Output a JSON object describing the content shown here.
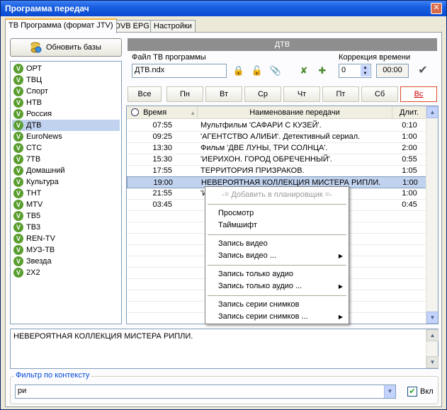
{
  "window": {
    "title": "Программа передач",
    "close_glyph": "✕"
  },
  "tabs": [
    "ТВ Программа (формат JTV)",
    "DVB EPG",
    "Настройки"
  ],
  "refresh_button": {
    "label": "Обновить базы",
    "icon": "database-refresh-icon"
  },
  "channels": [
    {
      "name": "ОРТ",
      "selected": false
    },
    {
      "name": "ТВЦ",
      "selected": false
    },
    {
      "name": "Спорт",
      "selected": false
    },
    {
      "name": "НТВ",
      "selected": false
    },
    {
      "name": "Россия",
      "selected": false
    },
    {
      "name": "ДТВ",
      "selected": true
    },
    {
      "name": "EuroNews",
      "selected": false
    },
    {
      "name": "СТС",
      "selected": false
    },
    {
      "name": "7ТВ",
      "selected": false
    },
    {
      "name": "Домашний",
      "selected": false
    },
    {
      "name": "Культура",
      "selected": false
    },
    {
      "name": "ТНТ",
      "selected": false
    },
    {
      "name": "MTV",
      "selected": false
    },
    {
      "name": "ТВ5",
      "selected": false
    },
    {
      "name": "ТВ3",
      "selected": false
    },
    {
      "name": "REN-TV",
      "selected": false
    },
    {
      "name": "МУЗ-ТВ",
      "selected": false
    },
    {
      "name": "Звезда",
      "selected": false
    },
    {
      "name": "2Х2",
      "selected": false
    }
  ],
  "channel_check_glyph": "V",
  "controls": {
    "header": "ДТВ",
    "file_label": "Файл ТВ программы",
    "file_value": "ДТВ.ndx",
    "time_correction_label": "Коррекция времени",
    "time_correction_value": "0",
    "time_offset_value": "00:00",
    "confirm_glyph": "✔"
  },
  "days": [
    {
      "label": "Все",
      "active": false
    },
    {
      "label": "Пн",
      "active": false
    },
    {
      "label": "Вт",
      "active": false
    },
    {
      "label": "Ср",
      "active": false
    },
    {
      "label": "Чт",
      "active": false
    },
    {
      "label": "Пт",
      "active": false
    },
    {
      "label": "Сб",
      "active": false
    },
    {
      "label": "Вс",
      "active": true
    }
  ],
  "grid": {
    "columns": [
      "Время",
      "Наименование передачи",
      "Длит."
    ],
    "sort_glyph": "▲",
    "rows": [
      {
        "time": "07:55",
        "title": "Мультфильм 'САФАРИ С КУЗЕЙ'.",
        "duration": "0:10",
        "selected": false
      },
      {
        "time": "09:25",
        "title": "'АГЕНТСТВО АЛИБИ'. Детективный сериал.",
        "duration": "1:00",
        "selected": false
      },
      {
        "time": "13:30",
        "title": "Фильм 'ДВЕ ЛУНЫ, ТРИ СОЛНЦА'.",
        "duration": "2:00",
        "selected": false
      },
      {
        "time": "15:30",
        "title": "'ИЕРИХОН. ГОРОД ОБРЕЧЕННЫЙ'.",
        "duration": "0:55",
        "selected": false
      },
      {
        "time": "17:55",
        "title": "ТЕРРИТОРИЯ ПРИЗРАКОВ.",
        "duration": "1:05",
        "selected": false
      },
      {
        "time": "19:00",
        "title": "НЕВЕРОЯТНАЯ КОЛЛЕКЦИЯ МИСТЕРА РИПЛИ.",
        "duration": "1:00",
        "selected": true
      },
      {
        "time": "21:55",
        "title": "'И",
        "duration": "1:00",
        "selected": false
      },
      {
        "time": "03:45",
        "title": "",
        "duration": "0:45",
        "selected": false
      }
    ],
    "scroll_up": "▲",
    "scroll_down": "▼"
  },
  "context_menu": {
    "items": [
      {
        "label": "-= Добавить в планировщик =-",
        "disabled": true,
        "submenu": false
      },
      {
        "sep": true
      },
      {
        "label": "Просмотр",
        "disabled": false,
        "submenu": false
      },
      {
        "label": "Таймшифт",
        "disabled": false,
        "submenu": false
      },
      {
        "sep": true
      },
      {
        "label": "Запись видео",
        "disabled": false,
        "submenu": false
      },
      {
        "label": "Запись видео ...",
        "disabled": false,
        "submenu": true
      },
      {
        "sep": true
      },
      {
        "label": "Запись только аудио",
        "disabled": false,
        "submenu": false
      },
      {
        "label": "Запись только аудио ...",
        "disabled": false,
        "submenu": true
      },
      {
        "sep": true
      },
      {
        "label": "Запись серии снимков",
        "disabled": false,
        "submenu": false
      },
      {
        "label": "Запись серии снимков ...",
        "disabled": false,
        "submenu": true
      }
    ],
    "submenu_glyph": "▶"
  },
  "description": "НЕВЕРОЯТНАЯ КОЛЛЕКЦИЯ МИСТЕРА РИПЛИ.",
  "filter": {
    "legend": "Фильтр по контексту",
    "value": "ри",
    "dropdown_glyph": "▼",
    "enable_label": "Вкл",
    "enabled": true,
    "check_glyph": "✔"
  },
  "colors": {
    "selection": "#c1d2ee",
    "titlebar": "#0a4ad2",
    "active_day": "#cc0000",
    "filter_legend": "#0046d5"
  }
}
